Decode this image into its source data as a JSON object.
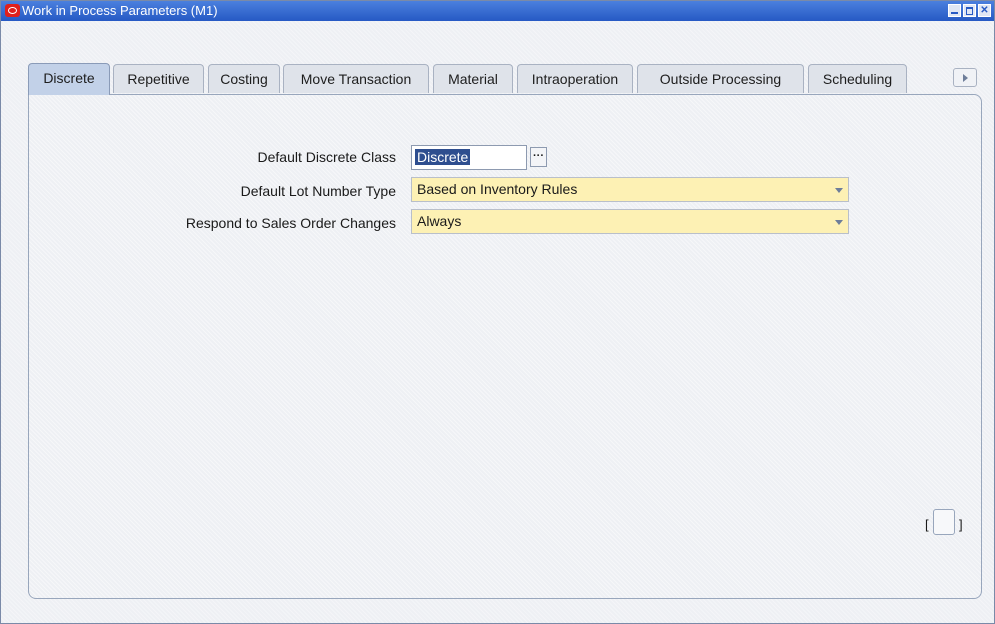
{
  "window": {
    "title": "Work in Process Parameters (M1)",
    "buttons": [
      "minimize",
      "maximize",
      "close"
    ]
  },
  "tabs": [
    {
      "label": "Discrete",
      "active": true
    },
    {
      "label": "Repetitive",
      "active": false
    },
    {
      "label": "Costing",
      "active": false
    },
    {
      "label": "Move Transaction",
      "active": false
    },
    {
      "label": "Material",
      "active": false
    },
    {
      "label": "Intraoperation",
      "active": false
    },
    {
      "label": "Outside Processing",
      "active": false
    },
    {
      "label": "Scheduling",
      "active": false
    }
  ],
  "form": {
    "default_discrete_class": {
      "label": "Default Discrete Class",
      "value": "Discrete"
    },
    "default_lot_number_type": {
      "label": "Default Lot Number Type",
      "value": "Based on Inventory Rules"
    },
    "respond_to_sales_order_changes": {
      "label": "Respond to Sales Order Changes",
      "value": "Always"
    }
  },
  "descriptive_flex": {
    "open_bracket": "[",
    "close_bracket": "]"
  },
  "colors": {
    "titlebar": "#2659c4",
    "required_field": "#fdf1b4",
    "active_tab": "#c2d1e8"
  }
}
